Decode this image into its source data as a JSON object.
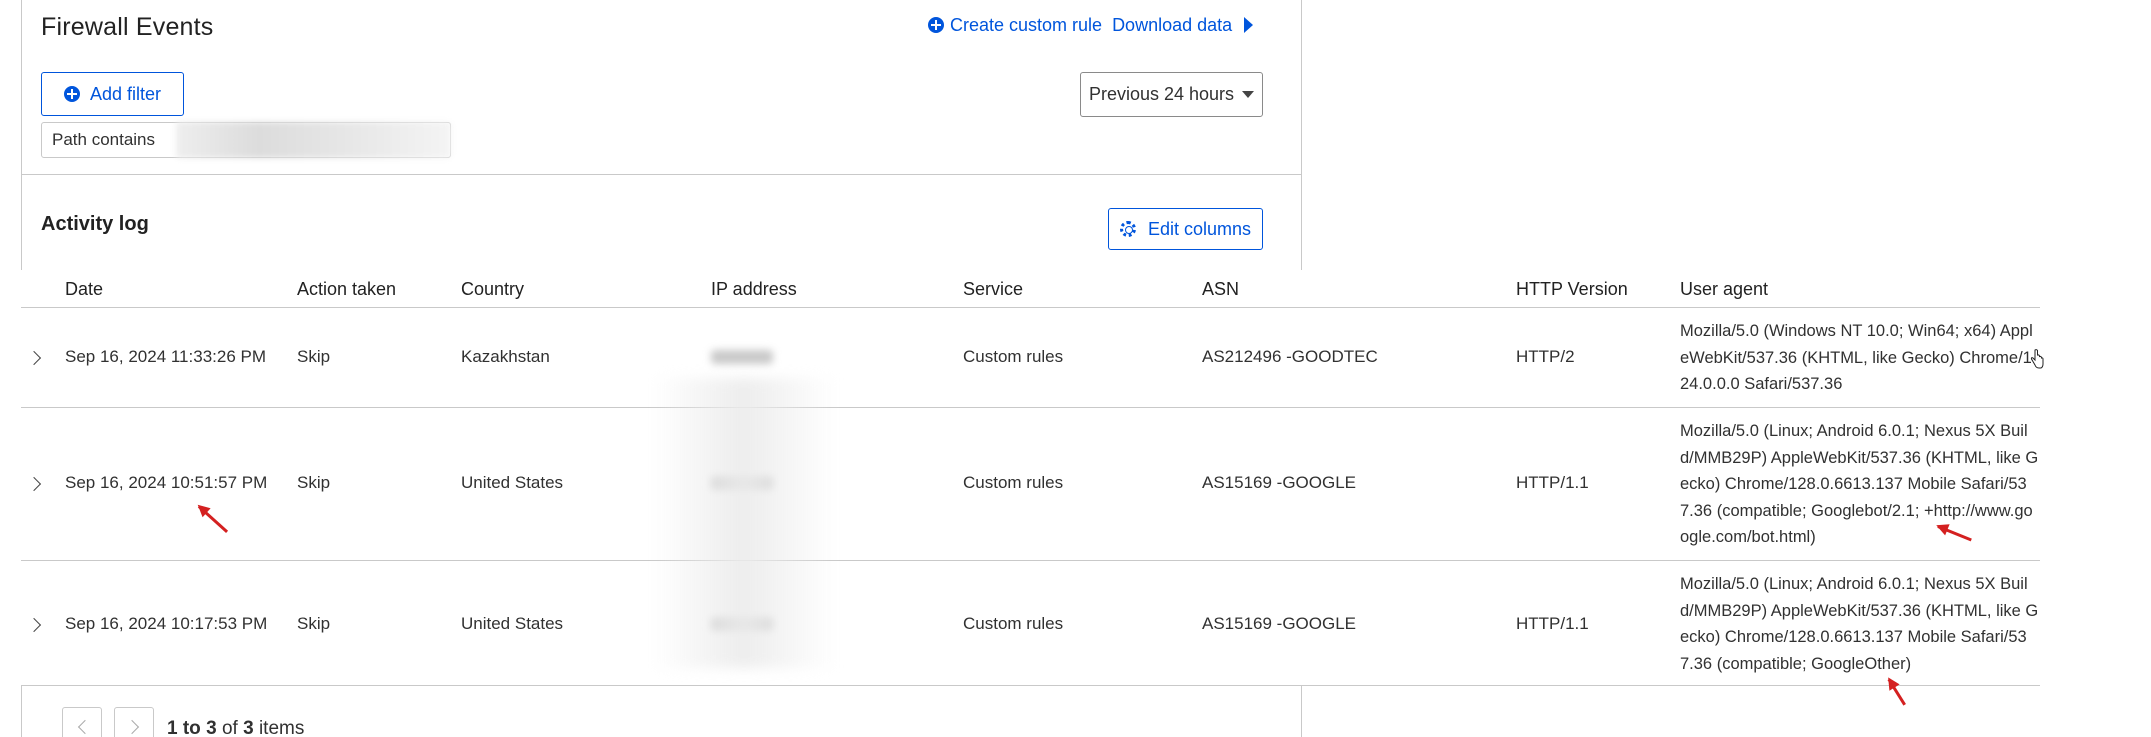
{
  "header": {
    "title": "Firewall Events",
    "create_rule": "Create custom rule",
    "download": "Download data"
  },
  "filters": {
    "add_filter": "Add filter",
    "time_range": "Previous 24 hours",
    "active_filter_prefix": "Path contains"
  },
  "activity": {
    "title": "Activity log",
    "edit_columns": "Edit columns"
  },
  "table": {
    "columns": [
      "Date",
      "Action taken",
      "Country",
      "IP address",
      "Service",
      "ASN",
      "HTTP Version",
      "User agent"
    ],
    "rows": [
      {
        "date": "Sep 16, 2024 11:33:26 PM",
        "action": "Skip",
        "country": "Kazakhstan",
        "service": "Custom rules",
        "asn": "AS212496 -GOODTEC",
        "http": "HTTP/2",
        "user_agent": "Mozilla/5.0 (Windows NT 10.0; Win64; x64) AppleWebKit/537.36 (KHTML, like Gecko) Chrome/124.0.0.0 Safari/537.36"
      },
      {
        "date": "Sep 16, 2024 10:51:57 PM",
        "action": "Skip",
        "country": "United States",
        "service": "Custom rules",
        "asn": "AS15169 -GOOGLE",
        "http": "HTTP/1.1",
        "user_agent": "Mozilla/5.0 (Linux; Android 6.0.1; Nexus 5X Build/MMB29P) AppleWebKit/537.36 (KHTML, like Gecko) Chrome/128.0.6613.137 Mobile Safari/537.36 (compatible; Googlebot/2.1; +http://www.google.com/bot.html)"
      },
      {
        "date": "Sep 16, 2024 10:17:53 PM",
        "action": "Skip",
        "country": "United States",
        "service": "Custom rules",
        "asn": "AS15169 -GOOGLE",
        "http": "HTTP/1.1",
        "user_agent": "Mozilla/5.0 (Linux; Android 6.0.1; Nexus 5X Build/MMB29P) AppleWebKit/537.36 (KHTML, like Gecko) Chrome/128.0.6613.137 Mobile Safari/537.36 (compatible; GoogleOther)"
      }
    ]
  },
  "pagination": {
    "range_start": "1",
    "range_to": "to",
    "range_end": "3",
    "of": "of",
    "total": "3",
    "items": "items"
  },
  "colors": {
    "accent": "#0055dc",
    "annotation_arrow": "#d42020",
    "border": "#c9c9c9"
  }
}
